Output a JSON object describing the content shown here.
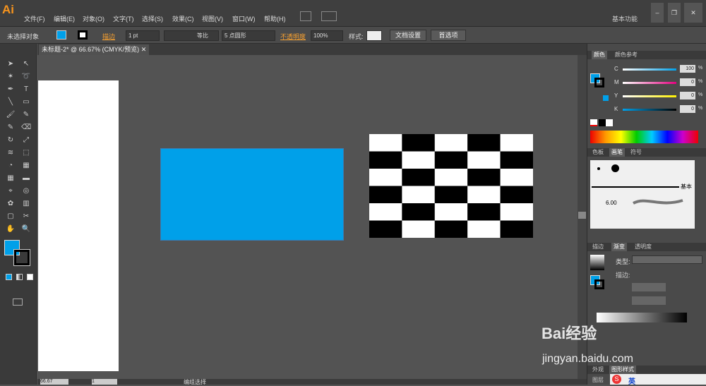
{
  "app": {
    "logo": "Ai"
  },
  "menu": [
    "文件(F)",
    "编辑(E)",
    "对象(O)",
    "文字(T)",
    "选择(S)",
    "效果(C)",
    "视图(V)",
    "窗口(W)",
    "帮助(H)"
  ],
  "workspace": {
    "label": "基本功能"
  },
  "control": {
    "selection": "未选择对象",
    "stroke_label": "描边",
    "stroke_weight": "1 pt",
    "stroke_profile": "等比",
    "brush": "5 点圆形",
    "opacity_label": "不透明度",
    "opacity_value": "100%",
    "style_label": "样式:",
    "doc_setup": "文档设置",
    "preferences": "首选项"
  },
  "document": {
    "tab_title": "未标题-2* @ 66.67% (CMYK/预览)",
    "zoom": "66.67",
    "page": "1",
    "status": "编组选择"
  },
  "artwork": {
    "fill_color": "#00a0e9",
    "check_rows": 6,
    "check_cols": 5
  },
  "color_panel": {
    "tabs": [
      "颜色",
      "颜色参考"
    ],
    "channels": [
      {
        "name": "C",
        "value": "100",
        "gradient": "linear-gradient(to right,#fff,#00a0e9)"
      },
      {
        "name": "M",
        "value": "0",
        "gradient": "linear-gradient(to right,#fff,#e4007f)"
      },
      {
        "name": "Y",
        "value": "0",
        "gradient": "linear-gradient(to right,#fff,#fff100)"
      },
      {
        "name": "K",
        "value": "0",
        "gradient": "linear-gradient(to right,#00a0e9,#000)"
      }
    ],
    "percent": "%"
  },
  "brush_panel": {
    "tabs": [
      "色板",
      "画笔",
      "符号"
    ],
    "basic_label": "基本",
    "size": "6.00"
  },
  "gradient_panel": {
    "tabs": [
      "描边",
      "渐变",
      "透明度"
    ],
    "type_label": "类型:",
    "stroke_label": "描边:"
  },
  "bottom_tabs": [
    "外观",
    "图形样式",
    "图层"
  ],
  "watermark": {
    "brand": "Bai经验",
    "url": "jingyan.baidu.com"
  },
  "ime": {
    "label": "英"
  }
}
